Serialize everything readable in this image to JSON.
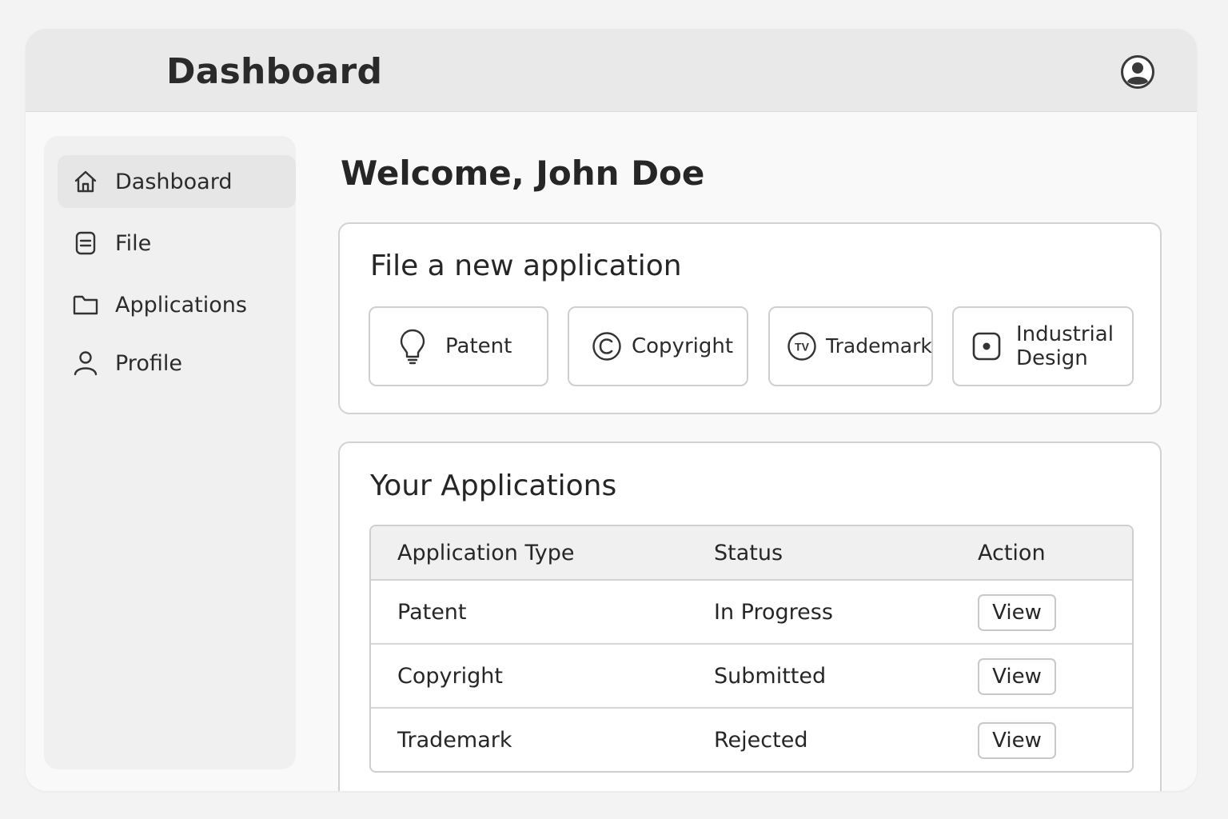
{
  "header": {
    "title": "Dashboard",
    "avatar_icon": "user-circle-icon"
  },
  "sidebar": {
    "items": [
      {
        "label": "Dashboard",
        "icon": "home-icon",
        "active": true
      },
      {
        "label": "File",
        "icon": "document-icon"
      },
      {
        "label": "Applications",
        "icon": "folder-icon"
      },
      {
        "label": "Profile",
        "icon": "person-icon"
      }
    ]
  },
  "main": {
    "welcome": "Welcome, John Doe",
    "new_application": {
      "title": "File a new application",
      "types": [
        {
          "label": "Patent",
          "icon": "lightbulb-icon"
        },
        {
          "label": "Copyright",
          "icon": "copyright-icon"
        },
        {
          "label": "Trademark",
          "icon": "trademark-icon"
        },
        {
          "label": "Industrial Design",
          "line1": "Industrial",
          "line2": "Design",
          "icon": "design-square-icon"
        }
      ]
    },
    "applications": {
      "title": "Your Applications",
      "columns": [
        "Application Type",
        "Status",
        "Action"
      ],
      "rows": [
        {
          "type": "Patent",
          "status": "In Progress",
          "action": "View"
        },
        {
          "type": "Copyright",
          "status": "Submitted",
          "action": "View"
        },
        {
          "type": "Trademark",
          "status": "Rejected",
          "action": "View"
        }
      ]
    }
  }
}
